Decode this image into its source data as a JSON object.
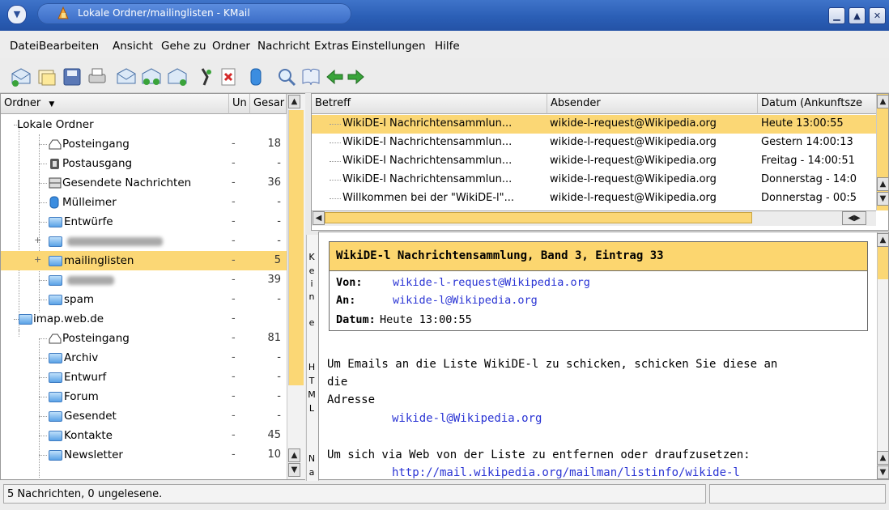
{
  "window": {
    "title": "Lokale Ordner/mailinglisten - KMail",
    "controls": {
      "minimize": "▁",
      "maximize": "▲",
      "close": "✕"
    }
  },
  "menu": [
    "Datei",
    "Bearbeiten",
    "Ansicht",
    "Gehe zu",
    "Ordner",
    "Nachricht",
    "Extras",
    "Einstellungen",
    "Hilfe"
  ],
  "folder_panel": {
    "headers": {
      "folder": "Ordner",
      "unread": "Un",
      "total": "Gesar"
    },
    "folders": [
      {
        "label": "Lokale Ordner",
        "un": "",
        "total": ""
      },
      {
        "label": "Posteingang",
        "un": "-",
        "total": "18"
      },
      {
        "label": "Postausgang",
        "un": "-",
        "total": "-"
      },
      {
        "label": "Gesendete Nachrichten",
        "un": "-",
        "total": "36"
      },
      {
        "label": "Mülleimer",
        "un": "-",
        "total": "-"
      },
      {
        "label": "Entwürfe",
        "un": "-",
        "total": "-"
      },
      {
        "label": "",
        "un": "-",
        "total": "-"
      },
      {
        "label": "mailinglisten",
        "un": "-",
        "total": "5"
      },
      {
        "label": "",
        "un": "-",
        "total": "39"
      },
      {
        "label": "spam",
        "un": "-",
        "total": "-"
      },
      {
        "label": "imap.web.de",
        "un": "-",
        "total": ""
      },
      {
        "label": "Posteingang",
        "un": "-",
        "total": "81"
      },
      {
        "label": "Archiv",
        "un": "-",
        "total": "-"
      },
      {
        "label": "Entwurf",
        "un": "-",
        "total": "-"
      },
      {
        "label": "Forum",
        "un": "-",
        "total": "-"
      },
      {
        "label": "Gesendet",
        "un": "-",
        "total": "-"
      },
      {
        "label": "Kontakte",
        "un": "-",
        "total": "45"
      },
      {
        "label": "Newsletter",
        "un": "-",
        "total": "10"
      }
    ]
  },
  "message_list": {
    "headers": {
      "subject": "Betreff",
      "sender": "Absender",
      "date": "Datum (Ankunftsze"
    },
    "messages": [
      {
        "subject": "WikiDE-l Nachrichtensammlun...",
        "sender": "wikide-l-request@Wikipedia.org",
        "date": "Heute 13:00:55"
      },
      {
        "subject": "WikiDE-l Nachrichtensammlun...",
        "sender": "wikide-l-request@Wikipedia.org",
        "date": "Gestern 14:00:13"
      },
      {
        "subject": "WikiDE-l Nachrichtensammlun...",
        "sender": "wikide-l-request@Wikipedia.org",
        "date": "Freitag - 14:00:51"
      },
      {
        "subject": "WikiDE-l Nachrichtensammlun...",
        "sender": "wikide-l-request@Wikipedia.org",
        "date": "Donnerstag - 14:0"
      },
      {
        "subject": "Willkommen bei der \"WikiDE-l\"...",
        "sender": "wikide-l-request@Wikipedia.org",
        "date": "Donnerstag - 00:5"
      }
    ]
  },
  "html_strip": [
    "K",
    "e",
    "i",
    "n",
    "e",
    "",
    "H",
    "T",
    "M",
    "L",
    "",
    "N",
    "a"
  ],
  "reader": {
    "title": "WikiDE-l Nachrichtensammlung, Band 3, Eintrag 33",
    "from_label": "Von:",
    "from": "wikide-l-request@Wikipedia.org",
    "to_label": "An:",
    "to": "wikide-l@Wikipedia.org",
    "date_label": "Datum:",
    "date": "Heute 13:00:55",
    "body_line1": "Um Emails an die Liste WikiDE-l zu schicken, schicken Sie diese an",
    "body_line2": "die",
    "body_line3": "Adresse",
    "body_link1": "wikide-l@Wikipedia.org",
    "body_line4": "Um sich via Web von der Liste zu entfernen oder draufzusetzen:",
    "body_link2": "http://mail.wikipedia.org/mailman/listinfo/wikide-l"
  },
  "status": {
    "text": "5 Nachrichten, 0 ungelesene."
  },
  "colors": {
    "selection": "#fbd775",
    "link": "#2a34d4",
    "titlebar": "#2b5fb6"
  }
}
